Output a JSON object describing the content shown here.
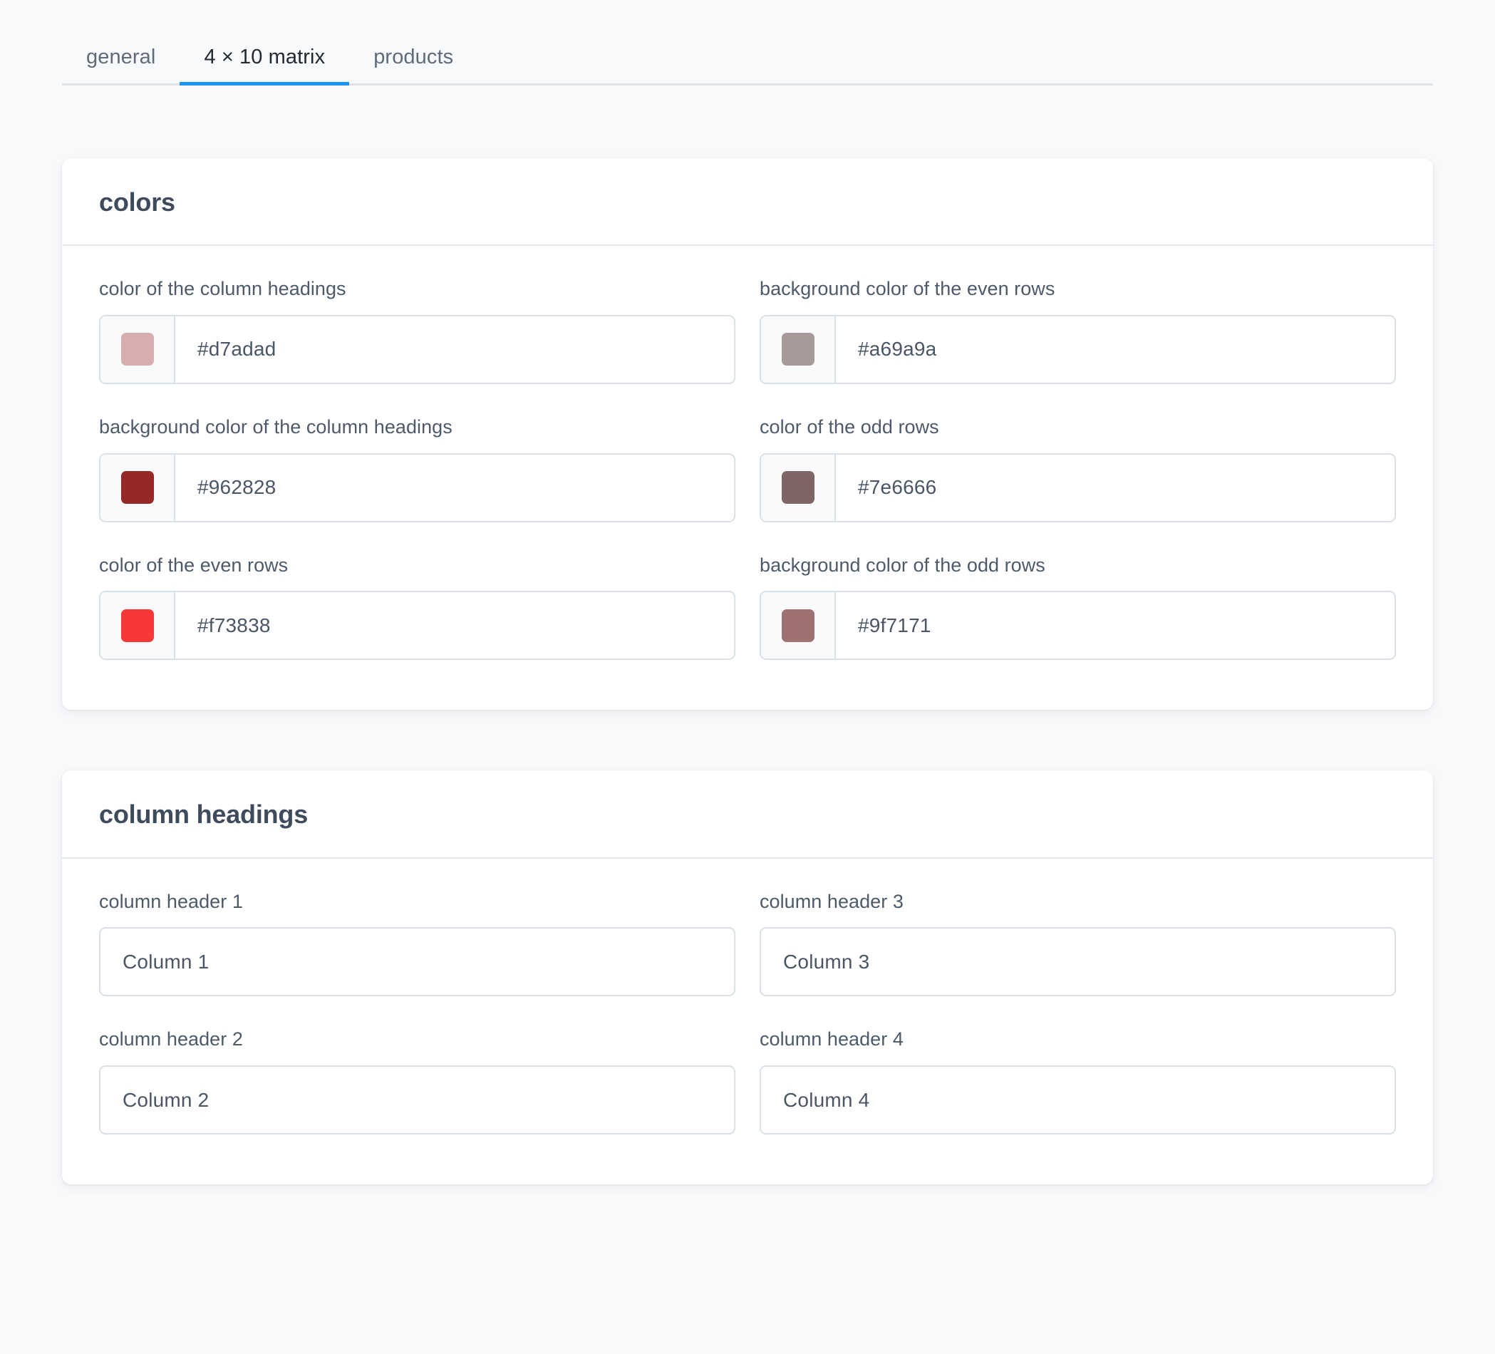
{
  "tabs": [
    {
      "label": "general",
      "active": false
    },
    {
      "label": "4 × 10 matrix",
      "active": true
    },
    {
      "label": "products",
      "active": false
    }
  ],
  "accent_color": "#1d95f0",
  "cards": [
    {
      "title": "colors",
      "fields": [
        {
          "label": "color of the column headings",
          "value": "#d7adad",
          "swatch": "#d7adad"
        },
        {
          "label": "background color of the even rows",
          "value": "#a69a9a",
          "swatch": "#a69a9a"
        },
        {
          "label": "background color of the column headings",
          "value": "#962828",
          "swatch": "#962828"
        },
        {
          "label": "color of the odd rows",
          "value": "#7e6666",
          "swatch": "#7e6666"
        },
        {
          "label": "color of the even rows",
          "value": "#f73838",
          "swatch": "#f73838"
        },
        {
          "label": "background color of the odd rows",
          "value": "#9f7171",
          "swatch": "#9f7171"
        }
      ]
    },
    {
      "title": "column headings",
      "fields": [
        {
          "label": "column header 1",
          "value": "Column 1"
        },
        {
          "label": "column header 3",
          "value": "Column 3"
        },
        {
          "label": "column header 2",
          "value": "Column 2"
        },
        {
          "label": "column header 4",
          "value": "Column 4"
        }
      ]
    }
  ]
}
